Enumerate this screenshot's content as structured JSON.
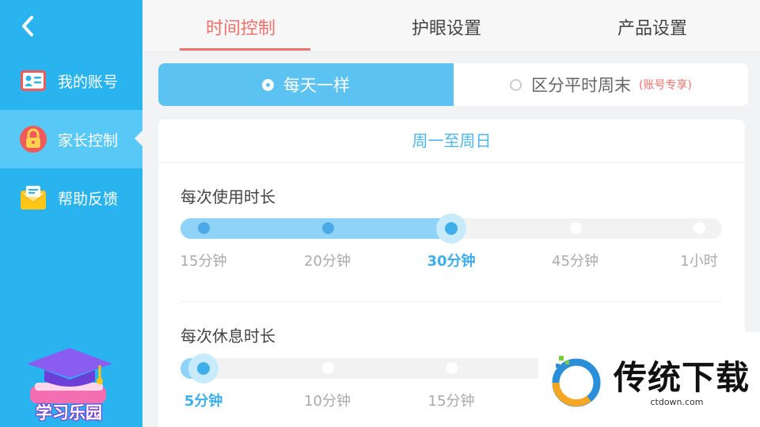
{
  "sidebar": {
    "items": [
      {
        "label": "我的账号",
        "icon": "id-card-icon"
      },
      {
        "label": "家长控制",
        "icon": "lock-icon"
      },
      {
        "label": "帮助反馈",
        "icon": "envelope-icon"
      }
    ],
    "logo_text": "学习乐园",
    "accent": "#29b4ef"
  },
  "tabs": [
    {
      "label": "时间控制"
    },
    {
      "label": "护眼设置"
    },
    {
      "label": "产品设置"
    }
  ],
  "mode": {
    "selected_label": "每天一样",
    "other_label": "区分平时周末",
    "other_tag": "(账号专享)"
  },
  "card": {
    "header": "周一至周日",
    "usage": {
      "title": "每次使用时长",
      "options": [
        "15分钟",
        "20分钟",
        "30分钟",
        "45分钟",
        "1小时"
      ],
      "selected_index": 2
    },
    "rest": {
      "title": "每次休息时长",
      "options": [
        "5分钟",
        "10分钟",
        "15分钟"
      ],
      "selected_index": 0
    }
  },
  "watermark": {
    "text": "传统下载",
    "url": "ctdown.com"
  }
}
